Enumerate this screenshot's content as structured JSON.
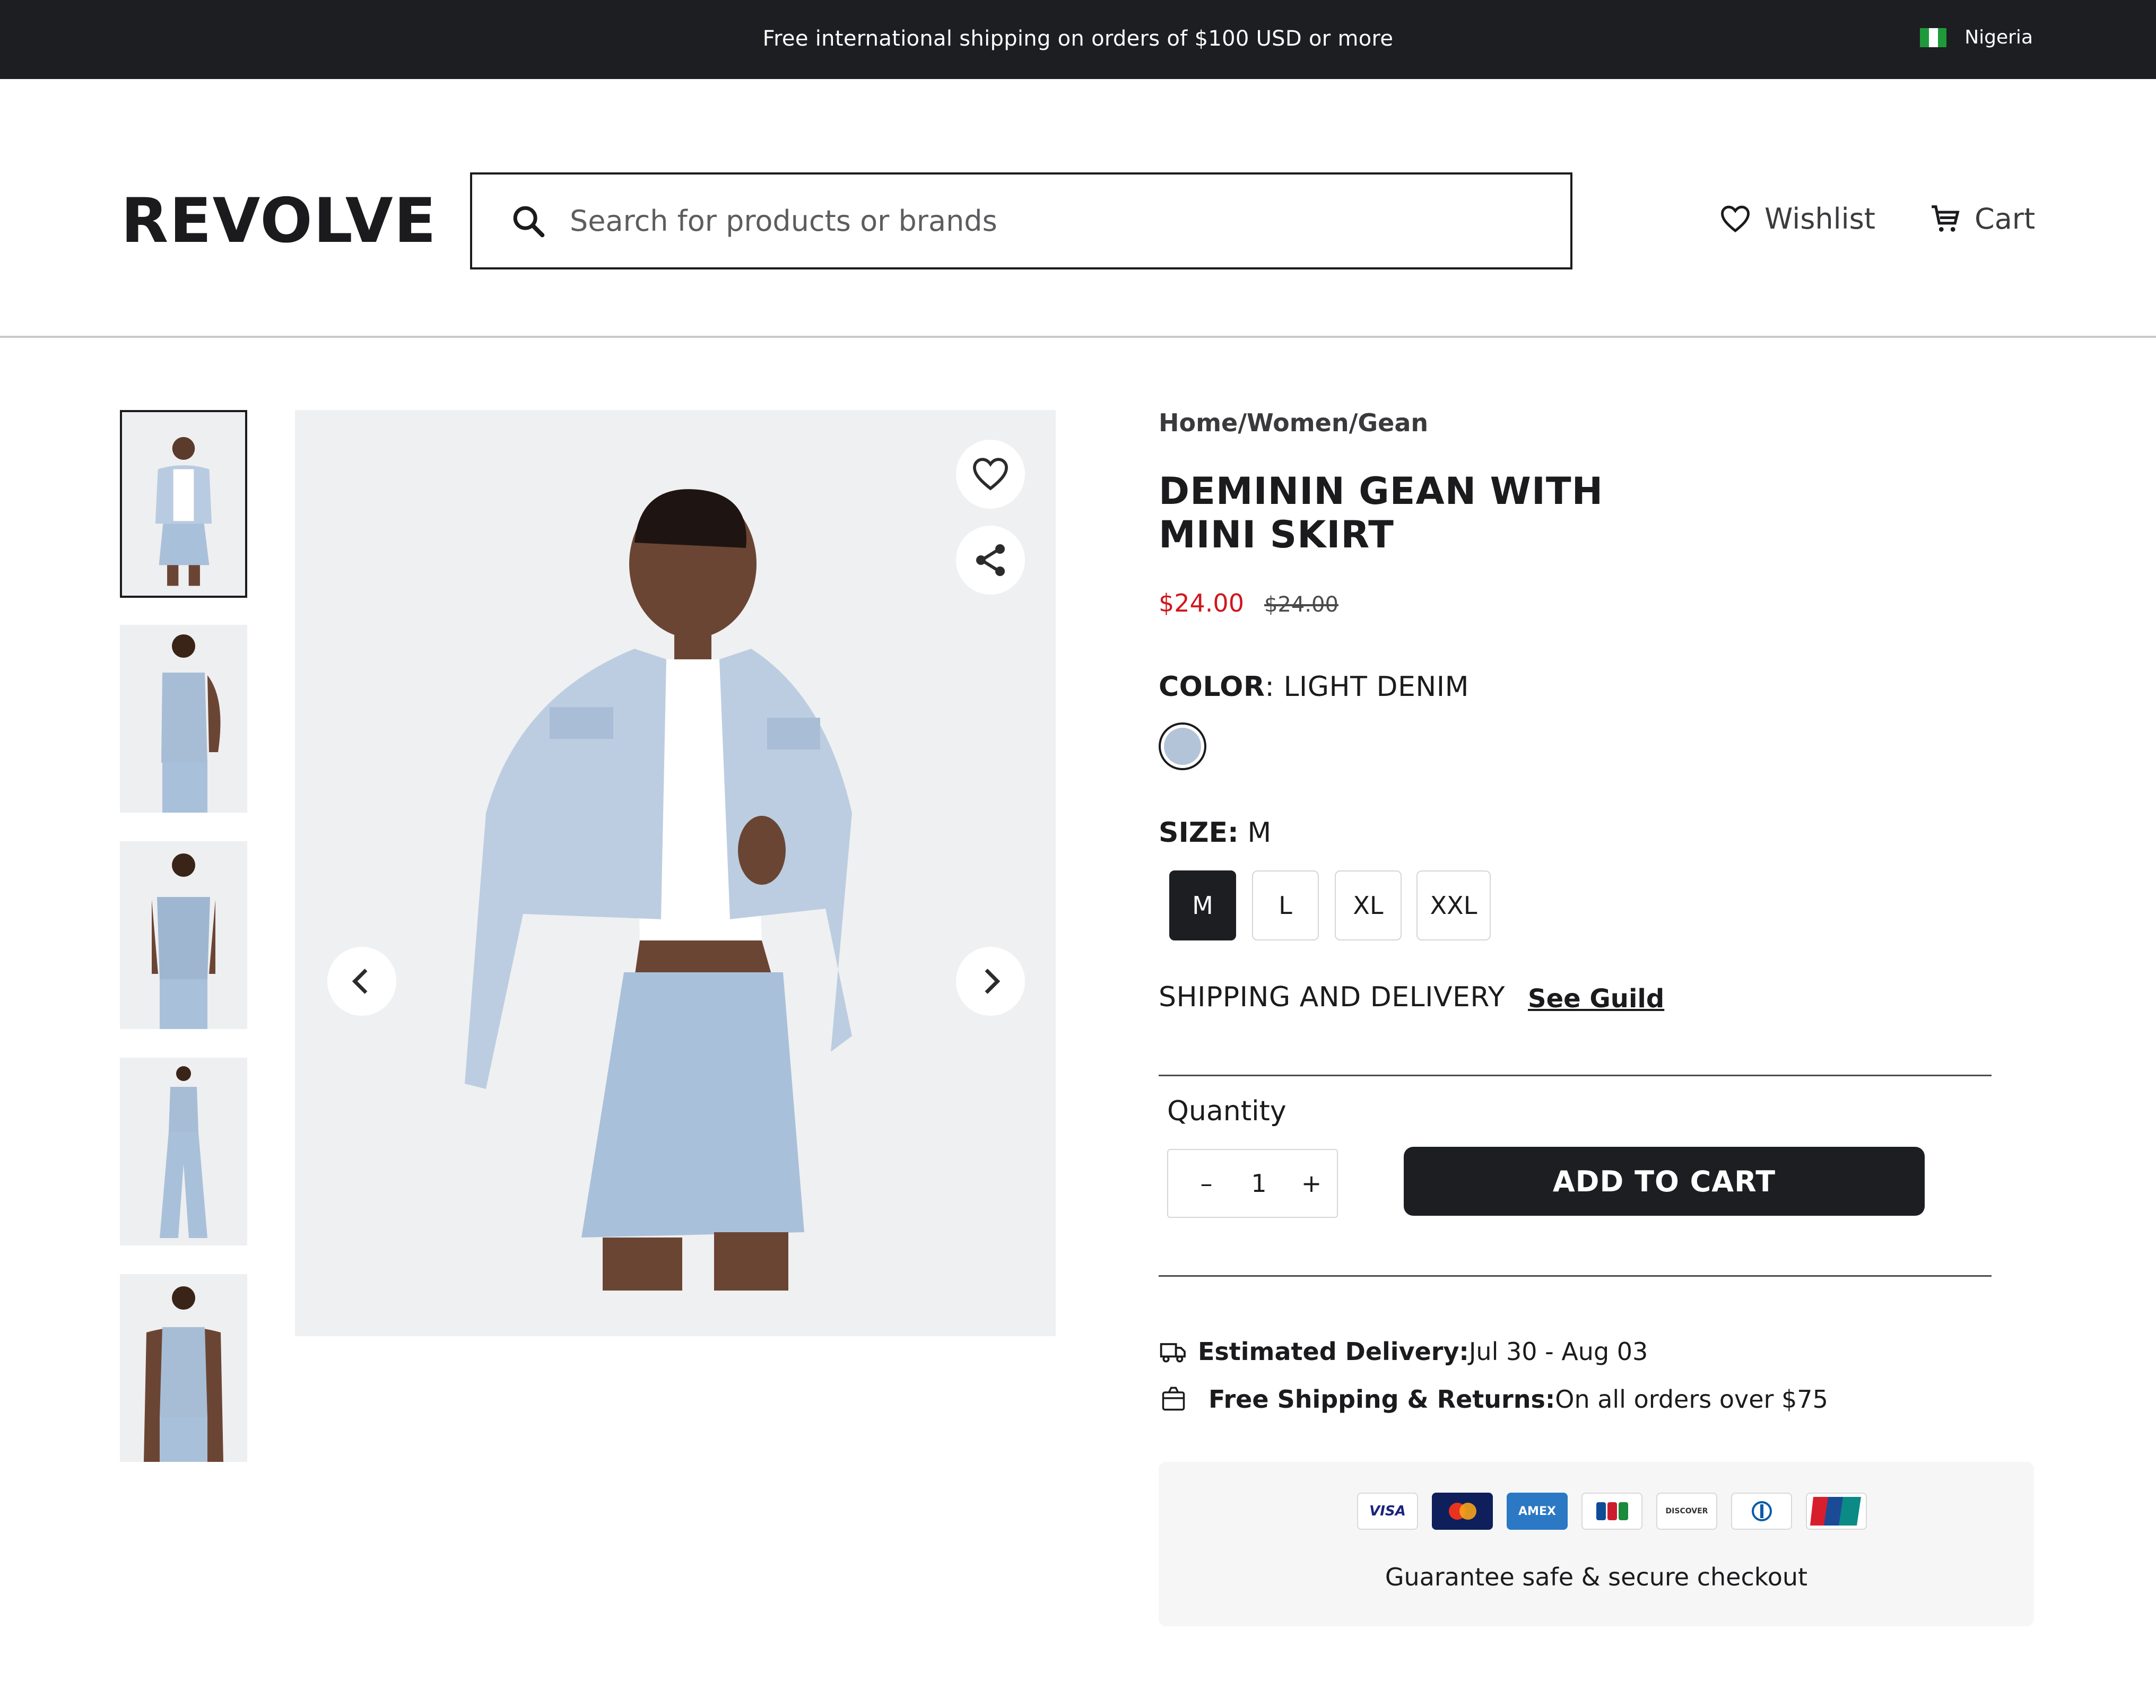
{
  "announcement": {
    "message": "Free international shipping on orders of $100 USD or more",
    "country": "Nigeria"
  },
  "header": {
    "logo": "REVOLVE",
    "search_placeholder": "Search for products or brands",
    "wishlist_label": "Wishlist",
    "cart_label": "Cart"
  },
  "gallery": {
    "thumbnails": [
      "front-jacket-skirt",
      "side-vest",
      "back-vest",
      "full-length-vest-flares",
      "front-vest"
    ],
    "selected_index": 0
  },
  "product": {
    "breadcrumb": "Home/Women/Gean",
    "title": "DEMININ GEAN WITH MINI SKIRT",
    "price": "$24.00",
    "original_price": "$24.00",
    "color_label": "COLOR",
    "color_value": ": LIGHT DENIM",
    "swatch_color": "#b4c4d8",
    "size_label": "SIZE:",
    "size_value": " M",
    "sizes": [
      "M",
      "L",
      "XL",
      "XXL"
    ],
    "selected_size": "M",
    "shipping_label": "SHIPPING AND DELIVERY",
    "guide_link": "See Guild",
    "quantity_label": "Quantity",
    "quantity_minus": "–",
    "quantity_value": "1",
    "quantity_plus": "+",
    "add_to_cart": "ADD TO CART",
    "estimated_delivery_label": "Estimated Delivery:",
    "estimated_delivery_value": " Jul 30 - Aug 03",
    "free_shipping_label": "Free Shipping & Returns:",
    "free_shipping_value": " On all orders over $75"
  },
  "payment": {
    "cards": [
      "VISA",
      "Mastercard",
      "AMEX",
      "JCB",
      "DISCOVER",
      "Diners Club",
      "UnionPay"
    ],
    "secure_text": "Guarantee safe & secure checkout"
  },
  "colors": {
    "dark": "#1d1e21",
    "sale_red": "#d0161c",
    "denim": "#b4c4d8"
  }
}
